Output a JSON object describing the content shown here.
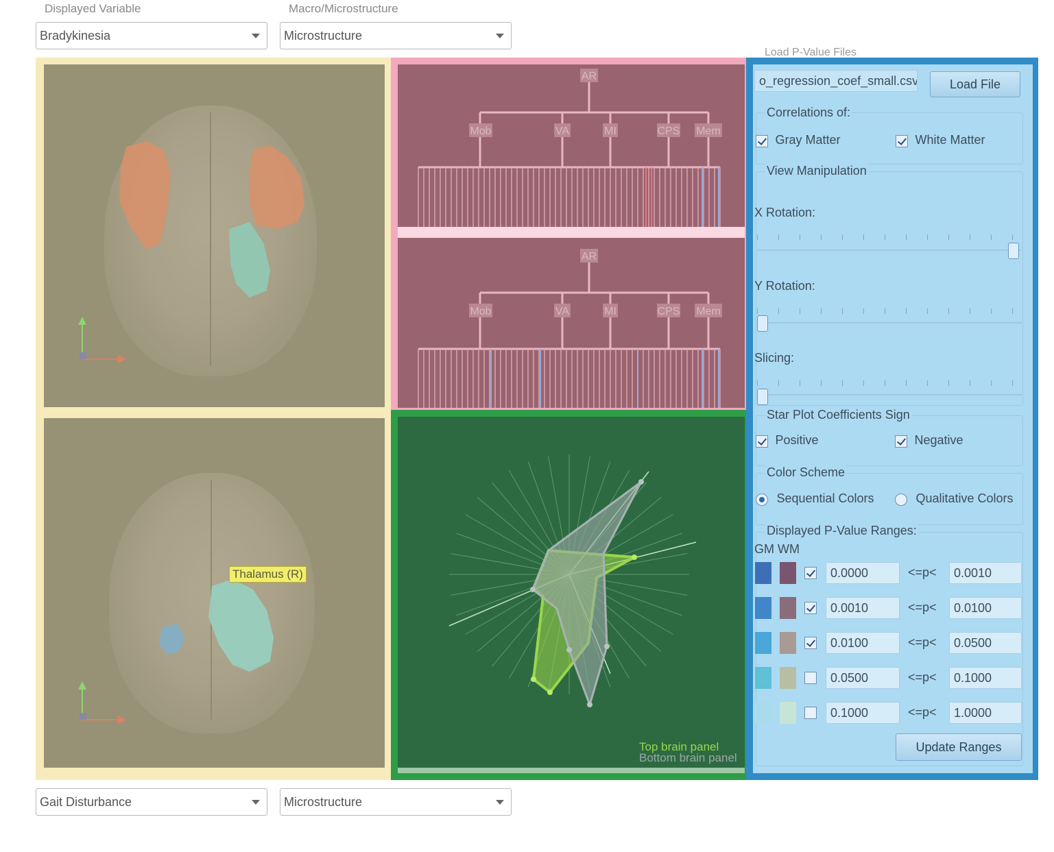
{
  "top_controls": {
    "displayed_variable_label": "Displayed Variable",
    "displayed_variable_value": "Bradykinesia",
    "macro_micro_label": "Macro/Microstructure",
    "macro_micro_value": "Microstructure"
  },
  "bottom_controls": {
    "displayed_variable_value": "Gait Disturbance",
    "macro_micro_value": "Microstructure"
  },
  "brain_bottom": {
    "tooltip": "Thalamus (R)"
  },
  "tree": {
    "root": "AR",
    "children": [
      "Mob",
      "VA",
      "MI",
      "CPS",
      "Mem"
    ]
  },
  "starplot": {
    "legend_top": "Top brain panel",
    "legend_bottom": "Bottom brain panel",
    "top_color": "#9ad64a",
    "bottom_color": "#9aa7a7"
  },
  "side_panel": {
    "load_title": "Load P-Value Files",
    "file_name": "o_regression_coef_small.csv",
    "load_button": "Load File",
    "correlations": {
      "title": "Correlations of:",
      "gray_matter": "Gray Matter",
      "white_matter": "White Matter",
      "gray_checked": true,
      "white_checked": true
    },
    "view": {
      "title": "View Manipulation",
      "x_rotation": "X Rotation:",
      "y_rotation": "Y Rotation:",
      "slicing": "Slicing:",
      "x_value": 1.0,
      "y_value": 0.0,
      "slicing_value": 0.0
    },
    "star_sign": {
      "title": "Star Plot Coefficients Sign",
      "positive": "Positive",
      "negative": "Negative"
    },
    "color_scheme": {
      "title": "Color Scheme",
      "sequential": "Sequential Colors",
      "qualitative": "Qualitative Colors",
      "selected": "sequential"
    },
    "ranges": {
      "title": "Displayed P-Value Ranges:",
      "gm_header": "GM",
      "wm_header": "WM",
      "op": "<=p<",
      "rows": [
        {
          "low": "0.0000",
          "high": "0.0010",
          "checked": true,
          "gm": "#3e6fb6",
          "wm": "#7a5570"
        },
        {
          "low": "0.0010",
          "high": "0.0100",
          "checked": true,
          "gm": "#4086c9",
          "wm": "#8a6c7a"
        },
        {
          "low": "0.0100",
          "high": "0.0500",
          "checked": true,
          "gm": "#4aa7d7",
          "wm": "#a99a93"
        },
        {
          "low": "0.0500",
          "high": "0.1000",
          "checked": false,
          "gm": "#5fc0d6",
          "wm": "#b6bea4"
        },
        {
          "low": "0.1000",
          "high": "1.0000",
          "checked": false,
          "gm": "#a9dcea",
          "wm": "#c7e5d6"
        }
      ],
      "update_button": "Update Ranges"
    }
  }
}
